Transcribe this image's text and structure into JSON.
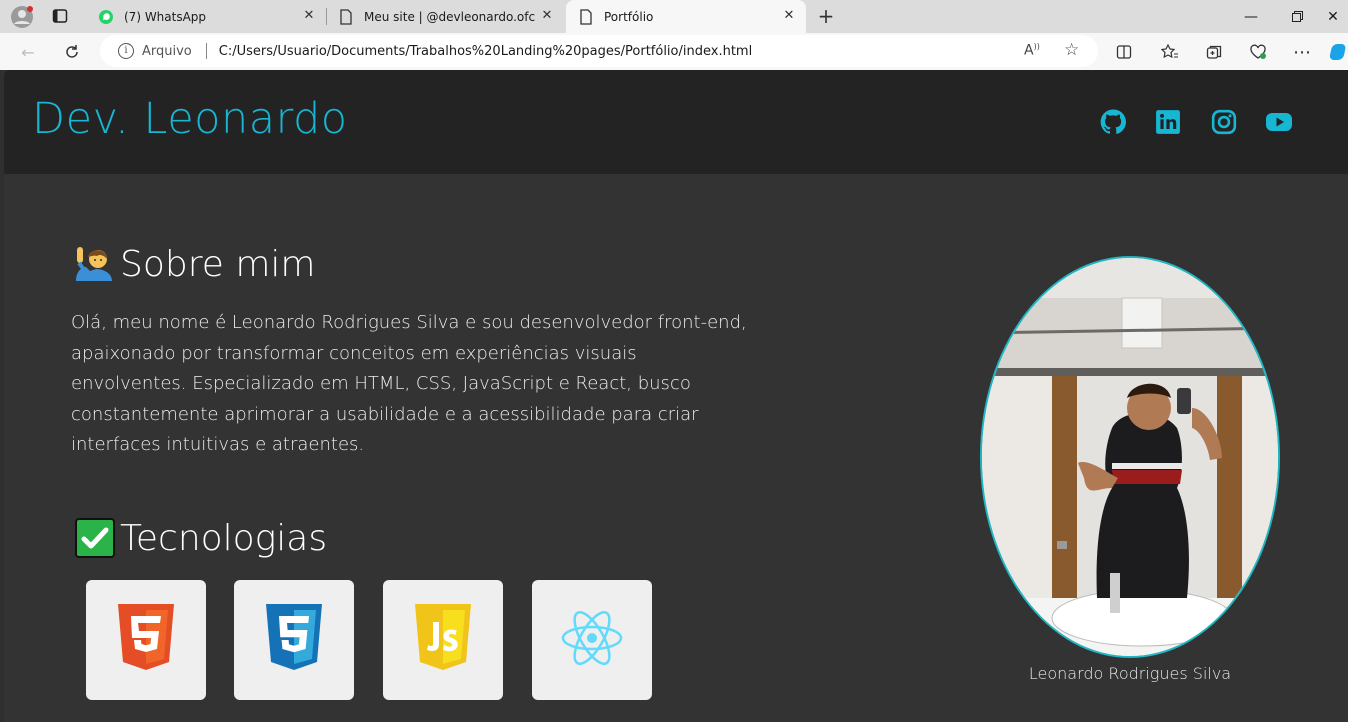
{
  "browser": {
    "tabs": [
      {
        "label": "(7) WhatsApp",
        "icon": "whatsapp-icon"
      },
      {
        "label": "Meu site | @devleonardo.ofc",
        "icon": "page-icon"
      },
      {
        "label": "Portfólio",
        "icon": "page-icon",
        "active": true
      }
    ],
    "address": {
      "scheme_label": "Arquivo",
      "url": "C:/Users/Usuario/Documents/Trabalhos%20Landing%20pages/Portfólio/index.html"
    }
  },
  "site": {
    "brand": "Dev. Leonardo",
    "social": [
      "github-icon",
      "linkedin-icon",
      "instagram-icon",
      "youtube-icon"
    ],
    "about": {
      "title": "Sobre mim",
      "text": "Olá, meu nome é Leonardo Rodrigues Silva e sou desenvolvedor front-end, apaixonado por transformar conceitos em experiências visuais envolventes. Especializado em HTML, CSS, JavaScript e React, busco constantemente aprimorar a usabilidade e a acessibilidade para criar interfaces intuitivas e atraentes."
    },
    "tech": {
      "title": "Tecnologias",
      "items": [
        "html5-icon",
        "css3-icon",
        "javascript-icon",
        "react-icon"
      ]
    },
    "profile": {
      "caption": "Leonardo Rodrigues Silva"
    }
  },
  "colors": {
    "accent": "#17b6d3",
    "header_bg": "#232323",
    "page_bg": "#333333"
  }
}
